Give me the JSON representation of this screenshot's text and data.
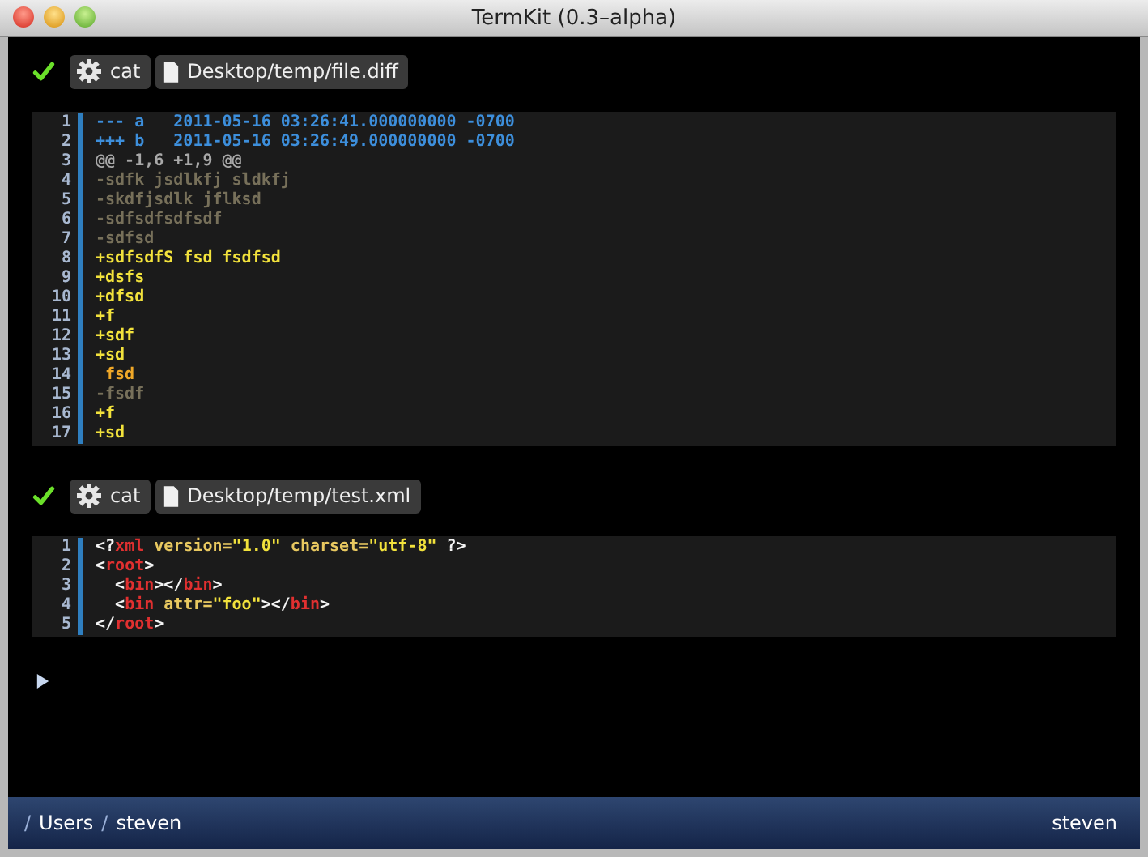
{
  "window": {
    "title": "TermKit (0.3–alpha)"
  },
  "commands": [
    {
      "success": true,
      "command": "cat",
      "path": "Desktop/temp/file.diff",
      "lines": [
        {
          "number": "1",
          "tokens": [
            {
              "kind": "header",
              "text": "--- a   2011-05-16 03:26:41.000000000 -0700"
            }
          ]
        },
        {
          "number": "2",
          "tokens": [
            {
              "kind": "header",
              "text": "+++ b   2011-05-16 03:26:49.000000000 -0700"
            }
          ]
        },
        {
          "number": "3",
          "tokens": [
            {
              "kind": "hunk",
              "text": "@@ -1,6 +1,9 @@"
            }
          ]
        },
        {
          "number": "4",
          "tokens": [
            {
              "kind": "removed",
              "text": "-sdfk jsdlkfj sldkfj"
            }
          ]
        },
        {
          "number": "5",
          "tokens": [
            {
              "kind": "removed",
              "text": "-skdfjsdlk jflksd"
            }
          ]
        },
        {
          "number": "6",
          "tokens": [
            {
              "kind": "removed",
              "text": "-sdfsdfsdfsdf"
            }
          ]
        },
        {
          "number": "7",
          "tokens": [
            {
              "kind": "removed",
              "text": "-sdfsd"
            }
          ]
        },
        {
          "number": "8",
          "tokens": [
            {
              "kind": "added",
              "text": "+sdfsdfS fsd fsdfsd"
            }
          ]
        },
        {
          "number": "9",
          "tokens": [
            {
              "kind": "added",
              "text": "+dsfs"
            }
          ]
        },
        {
          "number": "10",
          "tokens": [
            {
              "kind": "added",
              "text": "+dfsd"
            }
          ]
        },
        {
          "number": "11",
          "tokens": [
            {
              "kind": "added",
              "text": "+f"
            }
          ]
        },
        {
          "number": "12",
          "tokens": [
            {
              "kind": "added",
              "text": "+sdf"
            }
          ]
        },
        {
          "number": "13",
          "tokens": [
            {
              "kind": "added",
              "text": "+sd"
            }
          ]
        },
        {
          "number": "14",
          "tokens": [
            {
              "kind": "context",
              "text": " fsd"
            }
          ]
        },
        {
          "number": "15",
          "tokens": [
            {
              "kind": "removed",
              "text": "-fsdf"
            }
          ]
        },
        {
          "number": "16",
          "tokens": [
            {
              "kind": "added",
              "text": "+f"
            }
          ]
        },
        {
          "number": "17",
          "tokens": [
            {
              "kind": "added",
              "text": "+sd"
            }
          ]
        }
      ]
    },
    {
      "success": true,
      "command": "cat",
      "path": "Desktop/temp/test.xml",
      "lines": [
        {
          "number": "1",
          "tokens": [
            {
              "kind": "punct",
              "text": "<?"
            },
            {
              "kind": "tag",
              "text": "xml"
            },
            {
              "kind": "attr",
              "text": " version="
            },
            {
              "kind": "string",
              "text": "\"1.0\""
            },
            {
              "kind": "attr",
              "text": " charset="
            },
            {
              "kind": "string",
              "text": "\"utf-8\""
            },
            {
              "kind": "punct",
              "text": " ?>"
            }
          ]
        },
        {
          "number": "2",
          "tokens": [
            {
              "kind": "punct",
              "text": "<"
            },
            {
              "kind": "tag",
              "text": "root"
            },
            {
              "kind": "punct",
              "text": ">"
            }
          ]
        },
        {
          "number": "3",
          "tokens": [
            {
              "kind": "punct",
              "text": "  <"
            },
            {
              "kind": "tag",
              "text": "bin"
            },
            {
              "kind": "punct",
              "text": "></"
            },
            {
              "kind": "tag",
              "text": "bin"
            },
            {
              "kind": "punct",
              "text": ">"
            }
          ]
        },
        {
          "number": "4",
          "tokens": [
            {
              "kind": "punct",
              "text": "  <"
            },
            {
              "kind": "tag",
              "text": "bin"
            },
            {
              "kind": "attr",
              "text": " attr="
            },
            {
              "kind": "string",
              "text": "\"foo\""
            },
            {
              "kind": "punct",
              "text": "></"
            },
            {
              "kind": "tag",
              "text": "bin"
            },
            {
              "kind": "punct",
              "text": ">"
            }
          ]
        },
        {
          "number": "5",
          "tokens": [
            {
              "kind": "punct",
              "text": "</"
            },
            {
              "kind": "tag",
              "text": "root"
            },
            {
              "kind": "punct",
              "text": ">"
            }
          ]
        }
      ]
    }
  ],
  "status_bar": {
    "path": [
      {
        "text": "/"
      },
      {
        "text": "Users"
      },
      {
        "text": "/"
      },
      {
        "text": "steven"
      }
    ],
    "user": "steven"
  }
}
